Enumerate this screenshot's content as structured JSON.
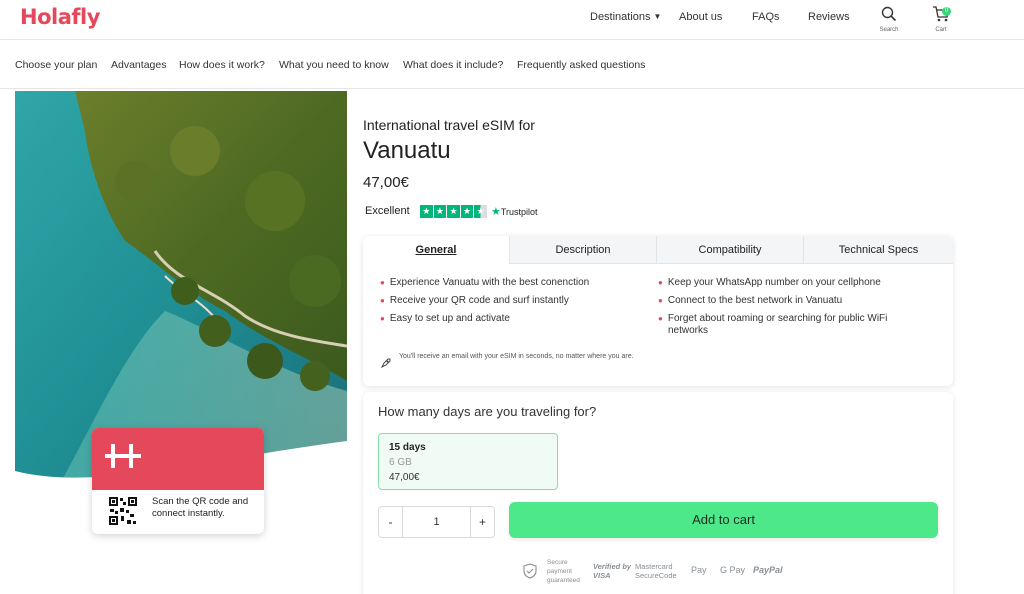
{
  "header": {
    "logo": "Holafly",
    "nav": [
      {
        "label": "Destinations"
      },
      {
        "label": "About us"
      },
      {
        "label": "FAQs"
      },
      {
        "label": "Reviews"
      }
    ],
    "search_label": "Search",
    "cart_label": "Cart",
    "cart_count": "0"
  },
  "subnav": [
    "Choose your plan",
    "Advantages",
    "How does it work?",
    "What you need to know",
    "What does it include?",
    "Frequently asked questions"
  ],
  "qr_card": {
    "text": "Scan the QR code and connect instantly."
  },
  "product": {
    "subtitle": "International travel eSIM for",
    "title": "Vanuatu",
    "price": "47,00€",
    "trustpilot_label": "Excellent",
    "trustpilot_brand": "Trustpilot",
    "rating_stars": 4.5
  },
  "tabs": [
    "General",
    "Description",
    "Compatibility",
    "Technical Specs"
  ],
  "features_left": [
    "Experience Vanuatu with the best conenction",
    "Receive your QR code and surf instantly",
    "Easy to set up and activate"
  ],
  "features_right": [
    "Keep your WhatsApp number on your cellphone",
    "Connect to the best network in Vanuatu",
    "Forget about roaming or searching for public WiFi networks"
  ],
  "email_note": "You'll receive an email with your eSIM in seconds, no matter where you are.",
  "days": {
    "question": "How many days are you traveling for?",
    "plan_days": "15 days",
    "plan_data": "6 GB",
    "plan_price": "47,00€"
  },
  "quantity": {
    "minus": "-",
    "value": "1",
    "plus": "+"
  },
  "add_to_cart": "Add to cart",
  "payments": {
    "secure": "Secure payment guaranteed",
    "visa": "Verified by VISA",
    "mastercard": "Mastercard SecureCode",
    "applepay": "Pay",
    "gpay": "G Pay",
    "paypal": "PayPal"
  },
  "colors": {
    "brand": "#e5485a",
    "accent_green": "#4de88a",
    "trustpilot_green": "#00b67a"
  }
}
